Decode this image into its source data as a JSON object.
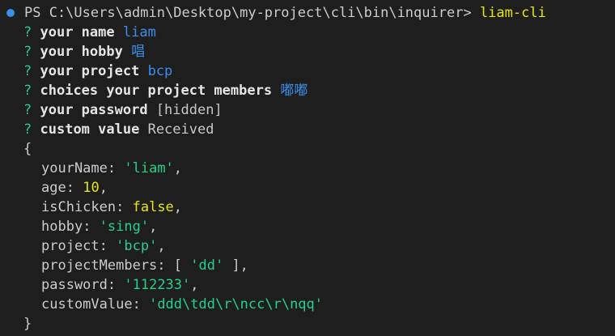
{
  "prompt": {
    "path": "PS C:\\Users\\admin\\Desktop\\my-project\\cli\\bin\\inquirer>",
    "command": "liam-cli"
  },
  "questions": [
    {
      "mark": "?",
      "label": "your name",
      "answer": "liam",
      "style": "ans"
    },
    {
      "mark": "?",
      "label": "your hobby",
      "answer": "唱",
      "style": "ans"
    },
    {
      "mark": "?",
      "label": "your project",
      "answer": "bcp",
      "style": "ans"
    },
    {
      "mark": "?",
      "label": "choices your project members",
      "answer": "嘟嘟",
      "style": "ans"
    },
    {
      "mark": "?",
      "label": "your password",
      "answer": "[hidden]",
      "style": "dim"
    },
    {
      "mark": "?",
      "label": "custom value",
      "answer": "Received",
      "style": "dim"
    }
  ],
  "output": {
    "open_brace": "{",
    "close_brace": "}",
    "fields": [
      {
        "key": "yourName",
        "value": "'liam'",
        "type": "str"
      },
      {
        "key": "age",
        "value": "10",
        "type": "num"
      },
      {
        "key": "isChicken",
        "value": "false",
        "type": "bool"
      },
      {
        "key": "hobby",
        "value": "'sing'",
        "type": "str"
      },
      {
        "key": "project",
        "value": "'bcp'",
        "type": "str"
      },
      {
        "key": "projectMembers",
        "value": "'dd'",
        "type": "arr"
      },
      {
        "key": "password",
        "value": "'112233'",
        "type": "str"
      },
      {
        "key": "customValue",
        "value": "'ddd\\tdd\\r\\ncc\\r\\nqq'",
        "type": "str"
      }
    ]
  },
  "colors": {
    "background": "#1e1e1e",
    "prompt_dot": "#3b8eea",
    "question_mark": "#23d18b",
    "answer": "#3b8eea",
    "string": "#23d18b",
    "number": "#e5e510",
    "command": "#e5e510"
  }
}
